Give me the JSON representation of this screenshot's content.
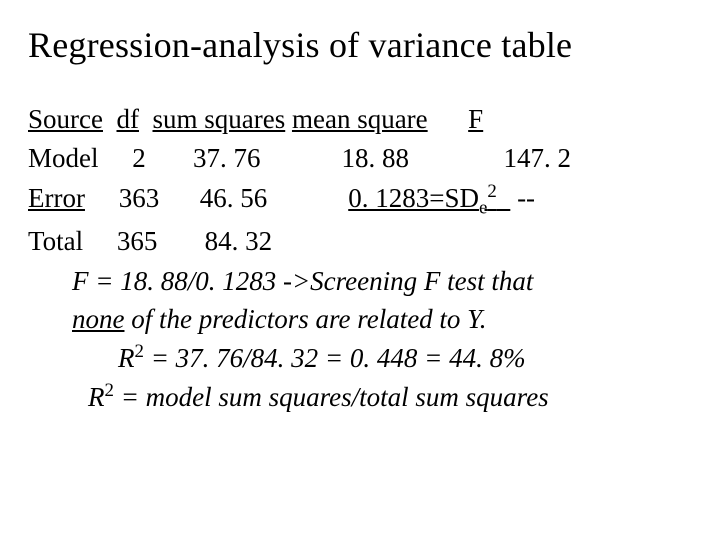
{
  "title": "Regression-analysis of variance table",
  "header": {
    "source": "Source",
    "df": "df",
    "ss": "sum squares",
    "ms": "mean square",
    "f": "F"
  },
  "rows": {
    "model": {
      "label": "Model",
      "df": "2",
      "ss": "37. 76",
      "ms": "18. 88",
      "f": "147. 2"
    },
    "error": {
      "label": "Error",
      "df": "363",
      "ss": "46. 56",
      "ms_pre": "0. 1283=SD",
      "ms_sub": "e",
      "ms_sup": "2",
      "f": "--"
    },
    "total": {
      "label": "Total",
      "df": "365",
      "ss": "84. 32"
    }
  },
  "explain": {
    "l1a": "F = 18. 88/0. 1283 ->Screening F test that",
    "l2a": "none",
    "l2b": " of the predictors are related to Y.",
    "l3a": "R",
    "l3sup": "2",
    "l3b": " = 37. 76/84. 32 = 0. 448 = 44. 8%",
    "l4a": "R",
    "l4sup": "2",
    "l4b": " = model sum squares/total sum squares"
  }
}
